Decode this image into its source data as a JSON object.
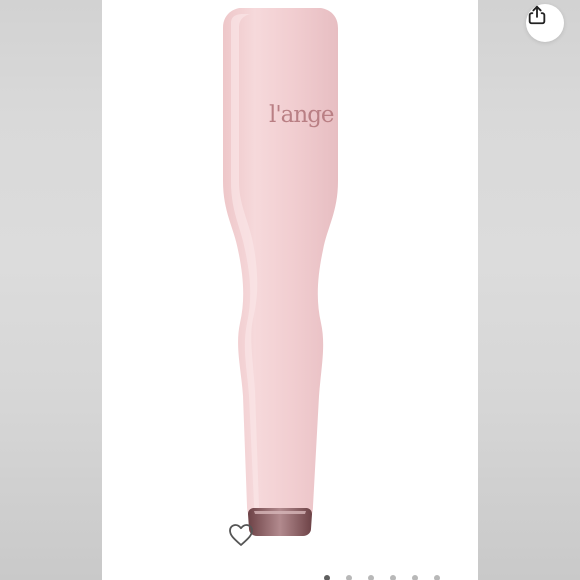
{
  "product": {
    "name": "l'ange",
    "logo_text": "l'ange",
    "body_color": "#f3d0d2",
    "logo_color": "#b97f84",
    "tip_color": "#7c4e52"
  },
  "actions": {
    "share_icon": "share-icon",
    "favorite_icon": "heart-outline-icon"
  },
  "carousel": {
    "total_slides": 6,
    "active_index": 0
  }
}
